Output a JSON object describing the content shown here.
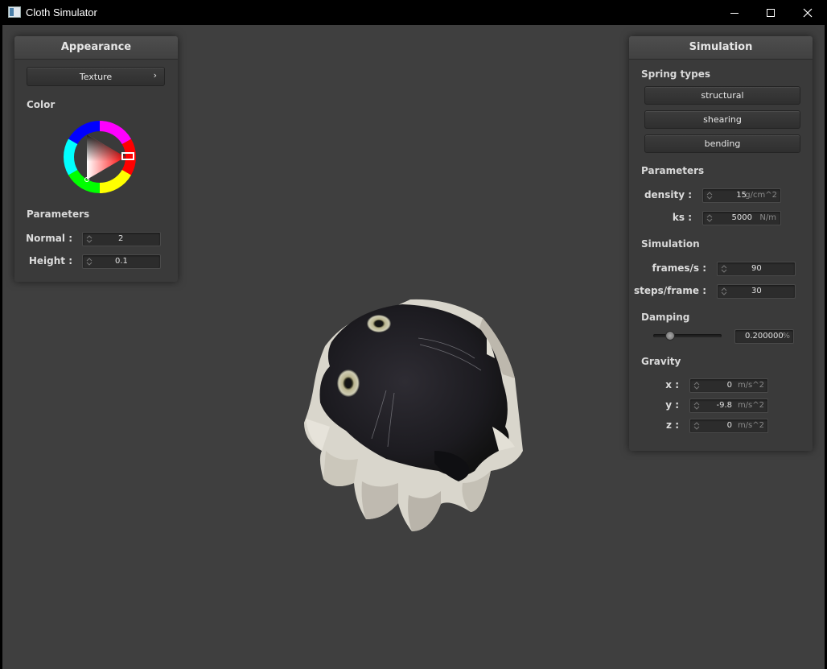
{
  "window": {
    "title": "Cloth Simulator"
  },
  "appearance": {
    "title": "Appearance",
    "texture_button": "Texture",
    "color_label": "Color",
    "params_label": "Parameters",
    "normal_label": "Normal :",
    "normal_value": "2",
    "height_label": "Height :",
    "height_value": "0.1"
  },
  "simulation_panel": {
    "title": "Simulation",
    "spring_types_label": "Spring types",
    "spring_buttons": [
      "structural",
      "shearing",
      "bending"
    ],
    "parameters_label": "Parameters",
    "density_label": "density :",
    "density_value": "15",
    "density_unit": "g/cm^2",
    "ks_label": "ks :",
    "ks_value": "5000",
    "ks_unit": "N/m",
    "simulation_label": "Simulation",
    "fps_label": "frames/s :",
    "fps_value": "90",
    "steps_label": "steps/frame :",
    "steps_value": "30",
    "damping_label": "Damping",
    "damping_value": "0.200000",
    "damping_unit": "%",
    "damping_slider_fraction": 0.2,
    "gravity_label": "Gravity",
    "gx_label": "x :",
    "gx_value": "0",
    "gy_label": "y :",
    "gy_value": "-9.8",
    "gz_label": "z :",
    "gz_value": "0",
    "gravity_unit": "m/s^2"
  },
  "colors": {
    "viewport_bg": "#3f3f3f",
    "panel_bg": "#3a3a3a",
    "selected_color": "#d42020"
  }
}
